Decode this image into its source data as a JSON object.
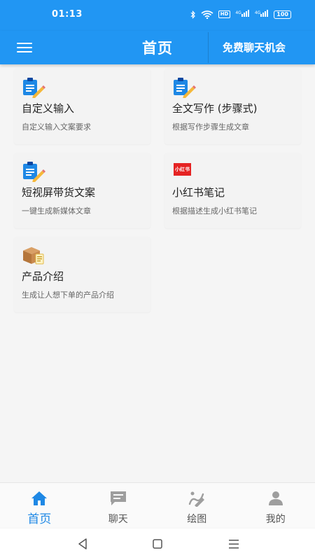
{
  "status_bar": {
    "time": "01:13",
    "hd_label": "HD",
    "signal_1": "4G",
    "signal_2": "4G",
    "battery": "100"
  },
  "app_bar": {
    "title": "首页",
    "free_chat_label": "免费聊天机会",
    "menu_icon": "hamburger-menu-icon"
  },
  "cards": [
    {
      "title": "自定义输入",
      "desc": "自定义输入文案要求",
      "icon": "clipboard-pencil-icon"
    },
    {
      "title": "全文写作 (步骤式)",
      "desc": "根据写作步骤生成文章",
      "icon": "clipboard-pencil-icon"
    },
    {
      "title": "短视屏带货文案",
      "desc": "一键生成新媒体文章",
      "icon": "clipboard-pencil-icon"
    },
    {
      "title": "小红书笔记",
      "desc": "根据描述生成小红书笔记",
      "icon": "xiaohongshu-logo-icon",
      "logo_text": "小红书"
    },
    {
      "title": "产品介绍",
      "desc": "生成让人想下单的产品介绍",
      "icon": "product-box-icon"
    }
  ],
  "tabs": [
    {
      "label": "首页",
      "icon": "home-icon",
      "active": true
    },
    {
      "label": "聊天",
      "icon": "chat-icon",
      "active": false
    },
    {
      "label": "绘图",
      "icon": "draw-icon",
      "active": false
    },
    {
      "label": "我的",
      "icon": "profile-icon",
      "active": false
    }
  ],
  "colors": {
    "primary": "#2196f3",
    "tab_active": "#1e88e5",
    "tab_inactive": "#9e9e9e",
    "xiaohongshu_red": "#e52323"
  }
}
